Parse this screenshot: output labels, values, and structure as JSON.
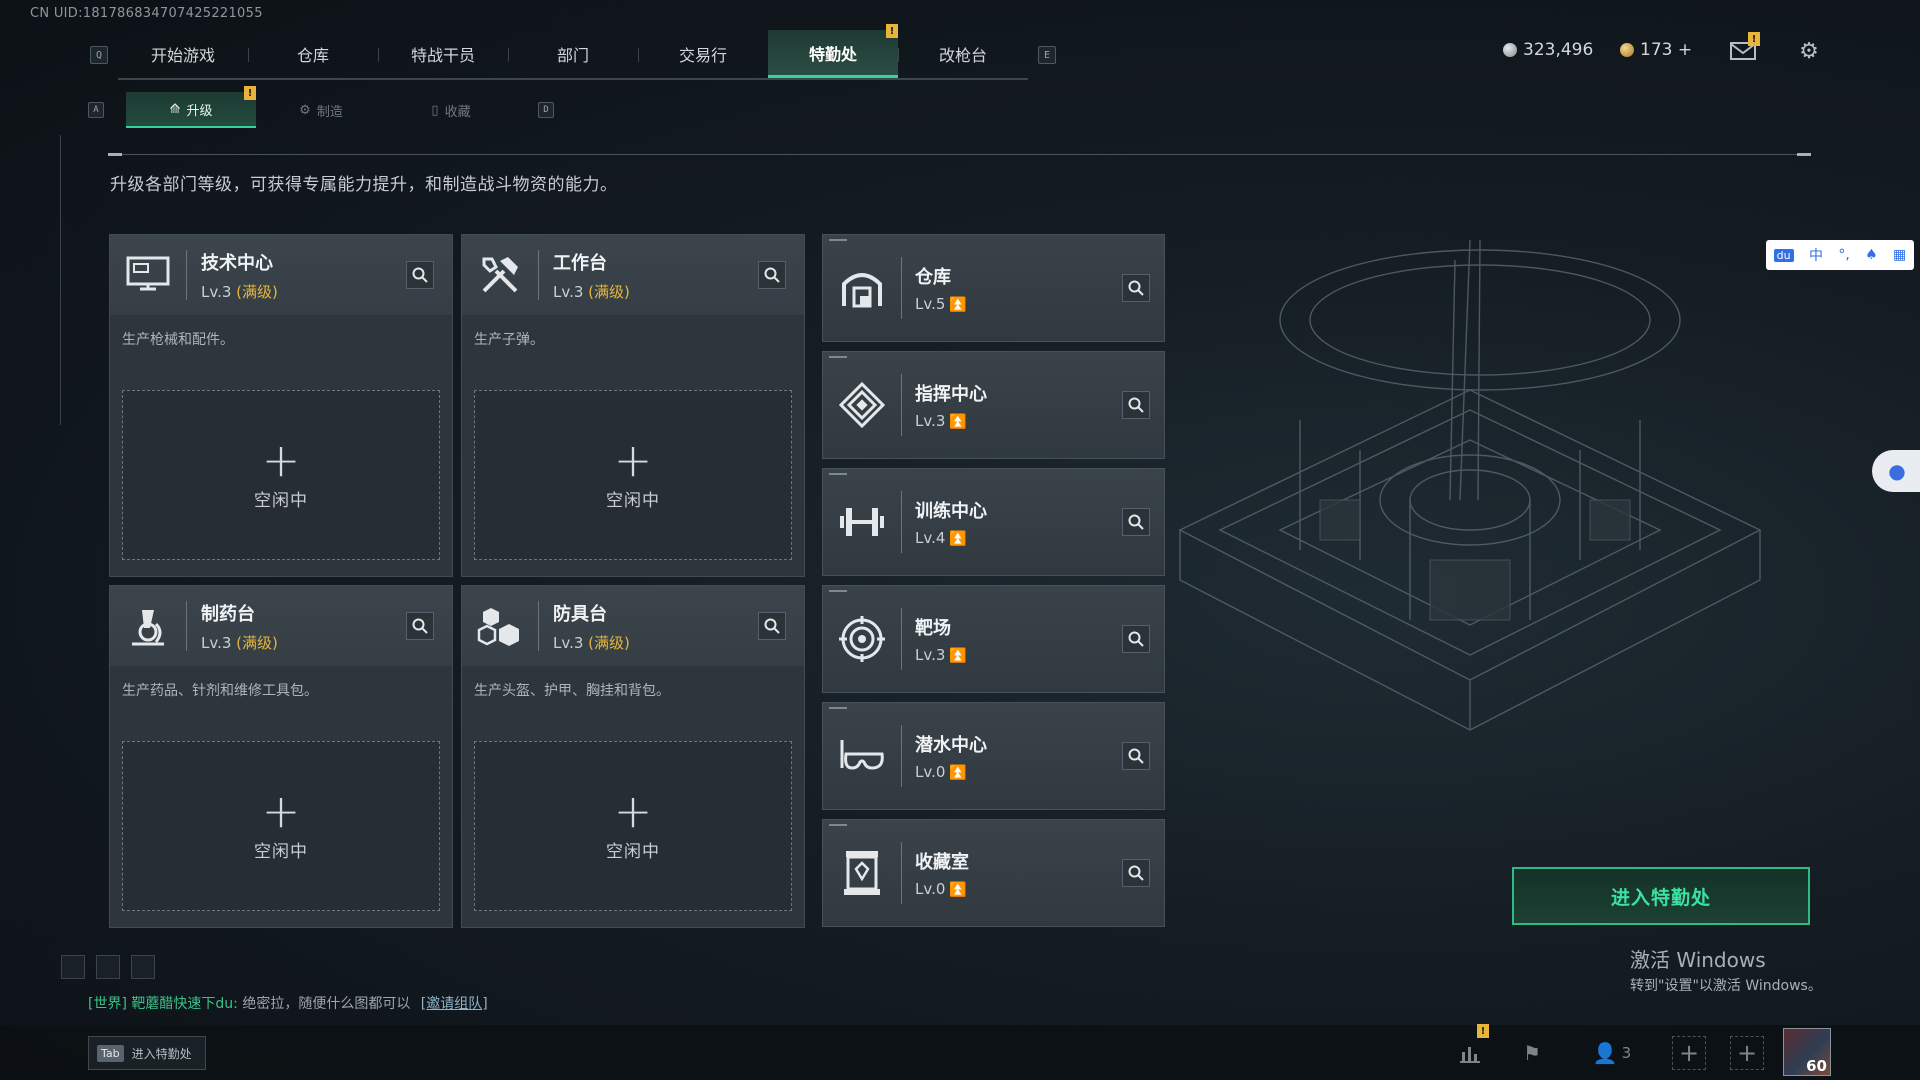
{
  "uid": "CN UID:1817868347074252210​55",
  "top_nav": {
    "left_key": "Q",
    "right_key": "E",
    "tabs": [
      {
        "label": "开始游戏"
      },
      {
        "label": "仓库"
      },
      {
        "label": "特战干员"
      },
      {
        "label": "部门"
      },
      {
        "label": "交易行"
      },
      {
        "label": "特勤处",
        "active": true,
        "badge": "!"
      },
      {
        "label": "改枪台"
      }
    ]
  },
  "currency": {
    "silver": "323,496",
    "gold": "173 +"
  },
  "mail_badge": "!",
  "sub_nav": {
    "left_key": "A",
    "right_key": "D",
    "tabs": [
      {
        "label": "升级",
        "active": true,
        "badge": "!"
      },
      {
        "label": "制造"
      },
      {
        "label": "收藏"
      }
    ]
  },
  "description": "升级各部门等级，可获得专属能力提升，和制造战斗物资的能力。",
  "production_cards": [
    {
      "name": "技术中心",
      "level": "Lv.3",
      "max": "(满级)",
      "desc": "生产枪械和配件。",
      "slot": "空闲中",
      "icon": "computer-icon"
    },
    {
      "name": "工作台",
      "level": "Lv.3",
      "max": "(满级)",
      "desc": "生产子弹。",
      "slot": "空闲中",
      "icon": "tools-icon"
    },
    {
      "name": "制药台",
      "level": "Lv.3",
      "max": "(满级)",
      "desc": "生产药品、针剂和维修工具包。",
      "slot": "空闲中",
      "icon": "microscope-icon"
    },
    {
      "name": "防具台",
      "level": "Lv.3",
      "max": "(满级)",
      "desc": "生产头盔、护甲、胸挂和背包。",
      "slot": "空闲中",
      "icon": "armor-blocks-icon"
    }
  ],
  "facility_cards": [
    {
      "name": "仓库",
      "level": "Lv.5",
      "icon": "warehouse-icon"
    },
    {
      "name": "指挥中心",
      "level": "Lv.3",
      "icon": "command-icon"
    },
    {
      "name": "训练中心",
      "level": "Lv.4",
      "icon": "dumbbell-icon"
    },
    {
      "name": "靶场",
      "level": "Lv.3",
      "icon": "target-icon"
    },
    {
      "name": "潜水中心",
      "level": "Lv.0",
      "icon": "diving-mask-icon"
    },
    {
      "name": "收藏室",
      "level": "Lv.0",
      "icon": "trophy-case-icon"
    }
  ],
  "enter_button": "进入特勤处",
  "activate_windows": {
    "title": "激活 Windows",
    "subtitle": "转到\"设置\"以激活 Windows。"
  },
  "ime_bar": {
    "logo": "du",
    "lang": "中"
  },
  "chat": {
    "channel": "[世界]",
    "sender": "靶蘑醋快速下du:",
    "message": " 绝密拉，随便什么图都可以 ",
    "link": "[邀请组队]"
  },
  "tab_hint": {
    "key": "Tab",
    "label": "进入特勤处"
  },
  "bottom": {
    "team_count": "3",
    "level": "60",
    "stats_badge": "!"
  },
  "colors": {
    "accent": "#34d39a",
    "gold": "#e8b53a",
    "panel": "#2d363c"
  }
}
